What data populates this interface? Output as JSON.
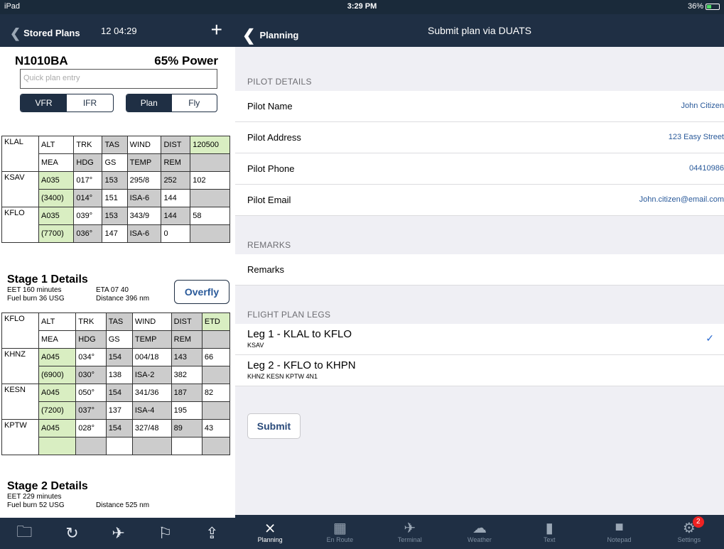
{
  "status": {
    "device": "iPad",
    "time": "3:29 PM",
    "battery": "36%"
  },
  "left": {
    "back": "Stored Plans",
    "time": "12 04:29",
    "add": "+",
    "aircraft": "N1010BA",
    "power": "65% Power",
    "quick_placeholder": "Quick plan entry",
    "seg1": [
      "VFR",
      "IFR"
    ],
    "seg2": [
      "Plan",
      "Fly"
    ],
    "header1": {
      "wp": "KLAL",
      "r1": [
        "ALT",
        "TRK",
        "TAS",
        "WIND",
        "DIST",
        "120500"
      ],
      "r2": [
        "MEA",
        "HDG",
        "GS",
        "TEMP",
        "REM",
        ""
      ]
    },
    "legs1": [
      {
        "wp": "KSAV",
        "r1": [
          "A035",
          "017°",
          "153",
          "295/8",
          "252",
          "102"
        ],
        "r2": [
          "(3400)",
          "014°",
          "151",
          "ISA-6",
          "144",
          ""
        ]
      },
      {
        "wp": "KFLO",
        "r1": [
          "A035",
          "039°",
          "153",
          "343/9",
          "144",
          "58"
        ],
        "r2": [
          "(7700)",
          "036°",
          "147",
          "ISA-6",
          "0",
          ""
        ]
      }
    ],
    "stage1": {
      "title": "Stage 1 Details",
      "eet": "EET 160 minutes",
      "eta": "ETA 07 40",
      "fuel": "Fuel burn 36 USG",
      "dist": "Distance 396 nm",
      "overfly": "Overfly"
    },
    "header2": {
      "wp": "KFLO",
      "r1": [
        "ALT",
        "TRK",
        "TAS",
        "WIND",
        "DIST",
        "ETD"
      ],
      "r2": [
        "MEA",
        "HDG",
        "GS",
        "TEMP",
        "REM",
        ""
      ]
    },
    "legs2": [
      {
        "wp": "KHNZ",
        "r1": [
          "A045",
          "034°",
          "154",
          "004/18",
          "143",
          "66"
        ],
        "r2": [
          "(6900)",
          "030°",
          "138",
          "ISA-2",
          "382",
          ""
        ]
      },
      {
        "wp": "KESN",
        "r1": [
          "A045",
          "050°",
          "154",
          "341/36",
          "187",
          "82"
        ],
        "r2": [
          "(7200)",
          "037°",
          "137",
          "ISA-4",
          "195",
          ""
        ]
      },
      {
        "wp": "KPTW",
        "r1": [
          "A045",
          "028°",
          "154",
          "327/48",
          "89",
          "43"
        ],
        "r2": [
          "",
          "",
          "",
          "",
          "",
          ""
        ]
      }
    ],
    "stage2": {
      "title": "Stage 2 Details",
      "eet": "EET 229 minutes",
      "fuel": "Fuel burn 52 USG",
      "dist": "Distance 525 nm"
    },
    "toolbar": [
      "folder-icon",
      "refresh-icon",
      "airplane-icon",
      "flag-icon",
      "share-icon"
    ]
  },
  "right": {
    "back": "Planning",
    "title": "Submit plan via DUATS",
    "sec_pilot": "PILOT DETAILS",
    "pilot": [
      {
        "k": "Pilot Name",
        "v": "John Citizen"
      },
      {
        "k": "Pilot Address",
        "v": "123 Easy Street"
      },
      {
        "k": "Pilot Phone",
        "v": "04410986"
      },
      {
        "k": "Pilot Email",
        "v": "John.citizen@email.com"
      }
    ],
    "sec_remarks": "REMARKS",
    "remarks": "Remarks",
    "sec_legs": "FLIGHT PLAN LEGS",
    "legs": [
      {
        "t": "Leg 1 - KLAL to KFLO",
        "s": "KSAV",
        "checked": "✓"
      },
      {
        "t": "Leg 2 - KFLO to KHPN",
        "s": "KHNZ KESN KPTW 4N1"
      }
    ],
    "submit": "Submit",
    "tabs": [
      "Planning",
      "En Route",
      "Terminal",
      "Weather",
      "Text",
      "Notepad",
      "Settings"
    ],
    "badge": "2"
  }
}
